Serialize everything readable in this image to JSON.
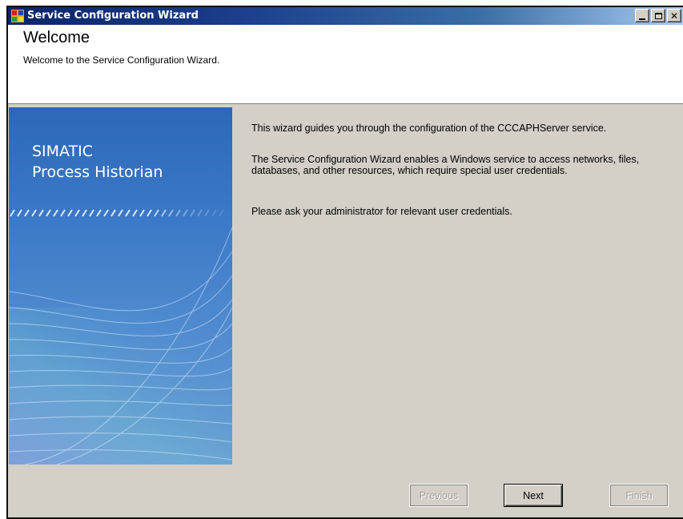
{
  "window": {
    "title": "Service Configuration Wizard",
    "controls": {
      "minimize": "",
      "maximize": "",
      "close": "✕"
    }
  },
  "header": {
    "title": "Welcome",
    "subtitle": "Welcome to the Service Configuration Wizard."
  },
  "sidebar": {
    "brand_line1": "SIMATIC",
    "brand_line2": "Process Historian"
  },
  "content": {
    "paragraph1": "This wizard guides you through the configuration of the CCCAPHServer service.",
    "paragraph2": "The Service Configuration Wizard enables a Windows service to access networks, files, databases, and other resources, which require special user credentials.",
    "paragraph3": "Please ask your administrator for relevant user credentials."
  },
  "buttons": {
    "previous": "Previous",
    "next": "Next",
    "finish": "Finish"
  },
  "colors": {
    "titlebar_start": "#0a246a",
    "titlebar_end": "#a6caf0",
    "panel_bg": "#d4d0c8",
    "sidebar_blue": "#3b78c6"
  }
}
